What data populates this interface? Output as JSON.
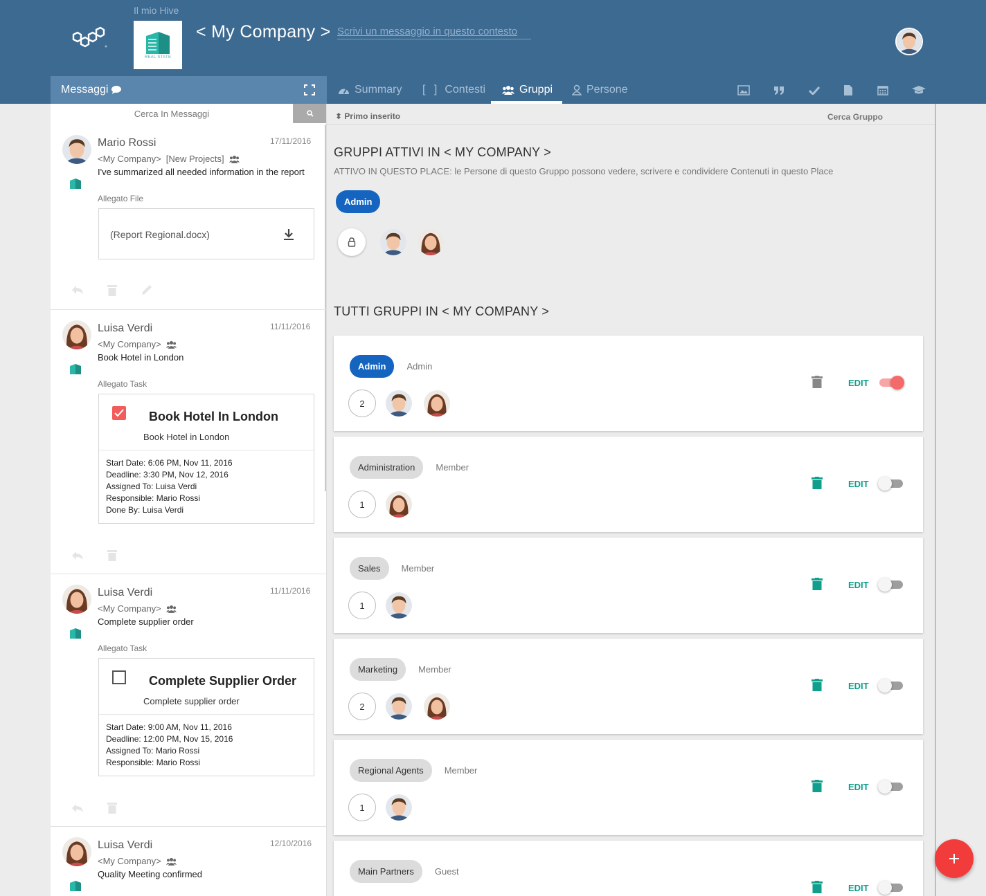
{
  "header": {
    "hive_label": "Il mio Hive",
    "company_logo_text": "REAL STATE",
    "title": "< My Company >",
    "message_placeholder": "Scrivi un messaggio in questo contesto"
  },
  "messages_panel": {
    "title": "Messaggi",
    "search_placeholder": "Cerca In Messaggi"
  },
  "tabs": [
    {
      "label": "Summary",
      "icon": "dashboard-icon",
      "active": false
    },
    {
      "label": "Contesti",
      "icon": "brackets-icon",
      "active": false
    },
    {
      "label": "Gruppi",
      "icon": "users-icon",
      "active": true
    },
    {
      "label": "Persone",
      "icon": "person-icon",
      "active": false
    }
  ],
  "toolbar_icons": [
    "image-icon",
    "quote-icon",
    "check-icon",
    "document-icon",
    "calendar-icon",
    "graduation-cap-icon"
  ],
  "messages": [
    {
      "author": "Mario Rossi",
      "date": "17/11/2016",
      "context": "<My Company>",
      "project": "[New Projects]",
      "body": "I've summarized all needed information in the report",
      "attachment_label": "Allegato File",
      "file_name": "(Report Regional.docx)"
    },
    {
      "author": "Luisa Verdi",
      "date": "11/11/2016",
      "context": "<My Company>",
      "body": "Book Hotel in London",
      "attachment_label": "Allegato Task",
      "task": {
        "title": "Book Hotel In London",
        "subtitle": "Book Hotel in London",
        "checked": true,
        "start": "Start Date: 6:06 PM, Nov 11, 2016",
        "deadline": "Deadline: 3:30 PM, Nov 12, 2016",
        "assigned": "Assigned To: Luisa Verdi",
        "responsible": "Responsible: Mario Rossi",
        "done_by": "Done By: Luisa Verdi"
      }
    },
    {
      "author": "Luisa Verdi",
      "date": "11/11/2016",
      "context": "<My Company>",
      "body": "Complete supplier order",
      "attachment_label": "Allegato Task",
      "task": {
        "title": "Complete Supplier Order",
        "subtitle": "Complete supplier order",
        "checked": false,
        "start": "Start Date: 9:00 AM, Nov 11, 2016",
        "deadline": "Deadline: 12:00 PM, Nov 15, 2016",
        "assigned": "Assigned To: Mario Rossi",
        "responsible": "Responsible: Mario Rossi"
      }
    },
    {
      "author": "Luisa Verdi",
      "date": "12/10/2016",
      "context": "<My Company>",
      "body": "Quality Meeting confirmed"
    }
  ],
  "groups_panel": {
    "sort_label": "Primo inserito",
    "search_label": "Cerca Gruppo",
    "active_title": "GRUPPI ATTIVI IN < MY COMPANY >",
    "active_desc": "ATTIVO IN QUESTO PLACE: le Persone di questo Gruppo possono vedere, scrivere e condividere Contenuti in questo Place",
    "active_chip": "Admin",
    "all_title": "TUTTI GRUPPI IN < MY COMPANY >",
    "edit_label": "EDIT",
    "groups": [
      {
        "name": "Admin",
        "role": "Admin",
        "count": "2",
        "enabled": true
      },
      {
        "name": "Administration",
        "role": "Member",
        "count": "1",
        "enabled": false
      },
      {
        "name": "Sales",
        "role": "Member",
        "count": "1",
        "enabled": false
      },
      {
        "name": "Marketing",
        "role": "Member",
        "count": "2",
        "enabled": false
      },
      {
        "name": "Regional Agents",
        "role": "Member",
        "count": "1",
        "enabled": false
      },
      {
        "name": "Main Partners",
        "role": "Guest",
        "count": "",
        "enabled": false
      }
    ]
  },
  "colors": {
    "header": "#3d6a91",
    "messages_bar": "#5a86ad",
    "chip_blue": "#1565c0",
    "edit_teal": "#0f9f8c",
    "fab_red": "#f23c3c",
    "toggle_on": "#f46a6a"
  }
}
